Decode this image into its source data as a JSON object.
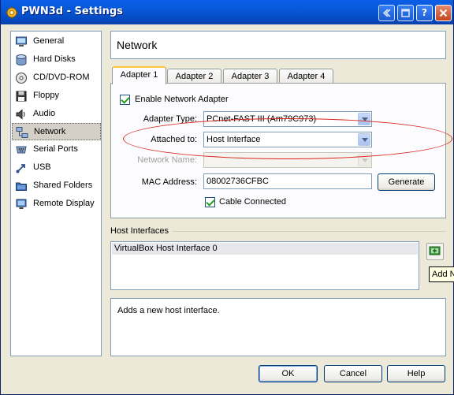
{
  "window": {
    "title": "PWN3d - Settings"
  },
  "sidebar": {
    "items": [
      {
        "label": "General",
        "icon": "general-icon"
      },
      {
        "label": "Hard Disks",
        "icon": "hard-disk-icon"
      },
      {
        "label": "CD/DVD-ROM",
        "icon": "cd-dvd-icon"
      },
      {
        "label": "Floppy",
        "icon": "floppy-icon"
      },
      {
        "label": "Audio",
        "icon": "audio-icon"
      },
      {
        "label": "Network",
        "icon": "network-icon",
        "selected": true
      },
      {
        "label": "Serial Ports",
        "icon": "serial-port-icon"
      },
      {
        "label": "USB",
        "icon": "usb-icon"
      },
      {
        "label": "Shared Folders",
        "icon": "shared-folder-icon"
      },
      {
        "label": "Remote Display",
        "icon": "remote-display-icon"
      }
    ]
  },
  "section": {
    "title": "Network"
  },
  "tabs": [
    {
      "label": "Adapter 1",
      "active": true
    },
    {
      "label": "Adapter 2"
    },
    {
      "label": "Adapter 3"
    },
    {
      "label": "Adapter 4"
    }
  ],
  "adapter": {
    "enable_label": "Enable Network Adapter",
    "enabled": true,
    "type_label": "Adapter Type:",
    "type_value": "PCnet-FAST III (Am79C973)",
    "attached_label": "Attached to:",
    "attached_value": "Host Interface",
    "netname_label": "Network Name:",
    "netname_value": "",
    "mac_label": "MAC Address:",
    "mac_value": "08002736CFBC",
    "generate_label": "Generate",
    "cable_label": "Cable Connected",
    "cable_connected": true
  },
  "host_interfaces": {
    "title": "Host Interfaces",
    "items": [
      "VirtualBox Host Interface 0"
    ],
    "add_tooltip": "Add N"
  },
  "description": {
    "text": "Adds a new host interface."
  },
  "buttons": {
    "ok": "OK",
    "cancel": "Cancel",
    "help": "Help"
  },
  "colors": {
    "titlebar": "#0858d8",
    "annotation": "#d9231c",
    "tab_highlight": "#ffc83c"
  }
}
